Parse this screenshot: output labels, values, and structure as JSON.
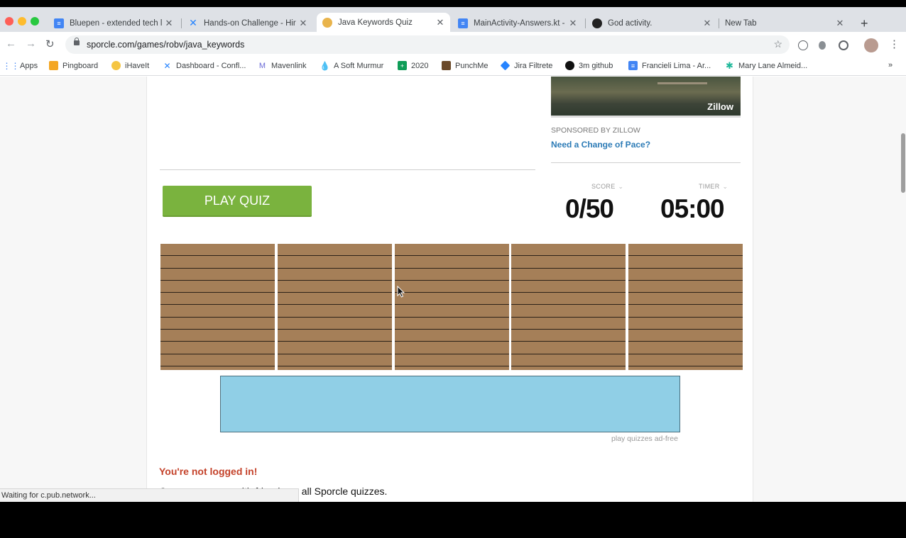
{
  "browser": {
    "tabs": [
      {
        "title": "Bluepen - extended tech l",
        "icon": "google-docs-icon",
        "active": false
      },
      {
        "title": "Hands-on Challenge - Hir",
        "icon": "confluence-icon",
        "active": false
      },
      {
        "title": "Java Keywords Quiz",
        "icon": "sporcle-icon",
        "active": true
      },
      {
        "title": "MainActivity-Answers.kt -",
        "icon": "google-docs-icon",
        "active": false
      },
      {
        "title": "God activity.",
        "icon": "github-icon",
        "active": false
      },
      {
        "title": "New Tab",
        "icon": "",
        "active": false
      }
    ],
    "new_tab_symbol": "+",
    "url": "sporcle.com/games/robv/java_keywords",
    "bookmarks": [
      {
        "label": "Apps",
        "icon": "apps-grid-icon"
      },
      {
        "label": "Pingboard",
        "icon": "pingboard-icon"
      },
      {
        "label": "iHaveIt",
        "icon": "ihaveit-icon"
      },
      {
        "label": "Dashboard - Confl...",
        "icon": "confluence-icon"
      },
      {
        "label": "Mavenlink",
        "icon": "mavenlink-icon"
      },
      {
        "label": "A Soft Murmur",
        "icon": "droplet-icon"
      },
      {
        "label": "2020",
        "icon": "sheets-icon"
      },
      {
        "label": "PunchMe",
        "icon": "punchme-icon"
      },
      {
        "label": "Jira Filtrete",
        "icon": "jira-icon"
      },
      {
        "label": "3m github",
        "icon": "github-icon"
      },
      {
        "label": "Francieli Lima - Ar...",
        "icon": "google-docs-icon"
      },
      {
        "label": "Mary Lane Almeid...",
        "icon": "star-app-icon"
      }
    ],
    "bookmarks_overflow": "»",
    "status": "Waiting for c.pub.network..."
  },
  "page": {
    "ad": {
      "logo": "Zillow",
      "sponsored": "SPONSORED BY ZILLOW",
      "link": "Need a Change of Pace?"
    },
    "play_button": "PLAY QUIZ",
    "score_label": "SCORE",
    "score_value": "0/50",
    "timer_label": "TIMER",
    "timer_value": "05:00",
    "answer_columns": 5,
    "answer_rows_per_column": 10,
    "ad_free_link": "play quizzes ad-free",
    "not_logged_in": "You're not logged in!",
    "compare_text": "Compare scores with friends on all Sporcle quizzes."
  },
  "colors": {
    "play_button": "#7ab33e",
    "answer_grid": "#a57f58",
    "banner": "#90cfe6",
    "warning_text": "#c4422a",
    "link": "#2c7bb6"
  }
}
